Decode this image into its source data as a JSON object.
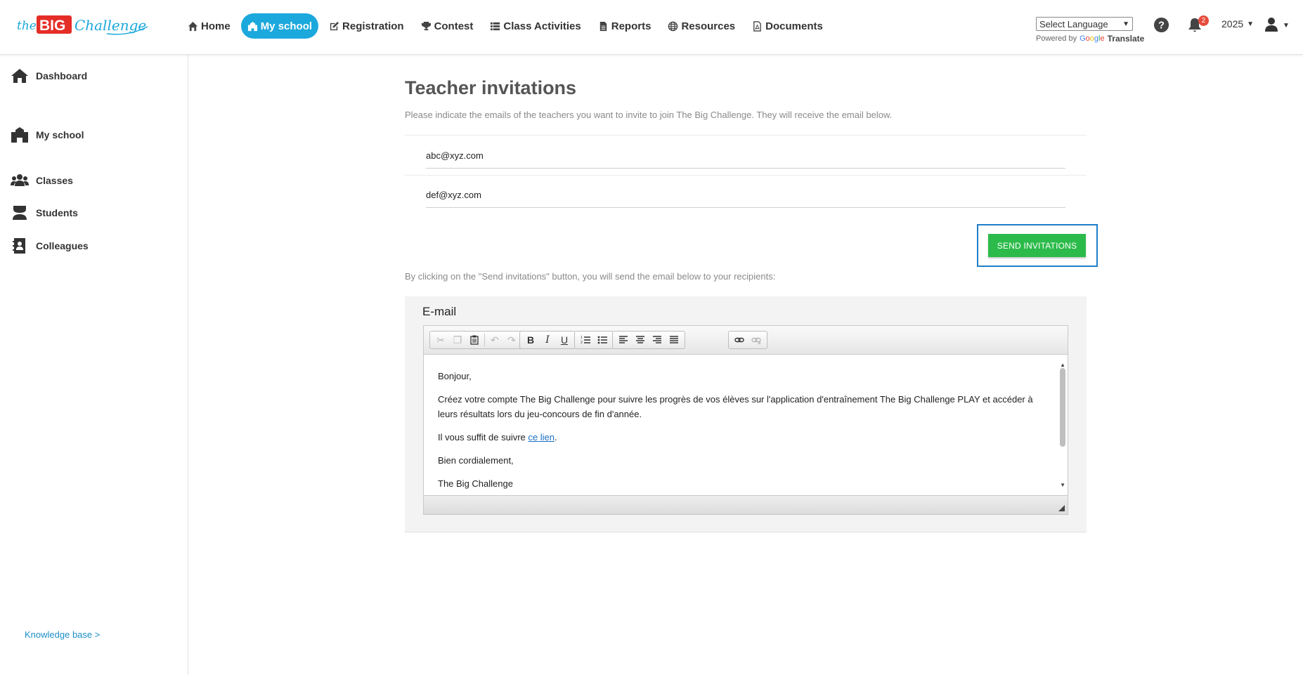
{
  "brand": {
    "logo_the": "the",
    "logo_big": "BIG",
    "logo_challenge": "Challenge",
    "accent": "#1ba8dc",
    "logo_red": "#e52d27"
  },
  "nav": {
    "items": [
      {
        "label": "Home",
        "icon": "home-icon"
      },
      {
        "label": "My school",
        "icon": "school-icon",
        "active": true
      },
      {
        "label": "Registration",
        "icon": "edit-icon"
      },
      {
        "label": "Contest",
        "icon": "trophy-icon"
      },
      {
        "label": "Class Activities",
        "icon": "list-icon"
      },
      {
        "label": "Reports",
        "icon": "file-text-icon"
      },
      {
        "label": "Resources",
        "icon": "globe-icon"
      },
      {
        "label": "Documents",
        "icon": "pdf-icon"
      }
    ]
  },
  "language": {
    "selected": "Select Language",
    "powered_by": "Powered by",
    "google": [
      "G",
      "o",
      "o",
      "g",
      "l",
      "e"
    ],
    "translate": "Translate"
  },
  "header": {
    "notification_count": "2",
    "year": "2025"
  },
  "sidebar": {
    "items": [
      {
        "label": "Dashboard",
        "icon": "home-icon"
      },
      {
        "label": "My school",
        "icon": "school-icon"
      },
      {
        "label": "Classes",
        "icon": "users-icon"
      },
      {
        "label": "Students",
        "icon": "student-icon"
      },
      {
        "label": "Colleagues",
        "icon": "contact-book-icon"
      }
    ],
    "knowledge_base": "Knowledge base >"
  },
  "main": {
    "title": "Teacher invitations",
    "subtitle": "Please indicate the emails of the teachers you want to invite to join The Big Challenge. They will receive the email below.",
    "emails": [
      "abc@xyz.com",
      "def@xyz.com"
    ],
    "send_button": "SEND INVITATIONS",
    "send_color": "#2cbb4a",
    "click_note": "By clicking on the \"Send invitations\" button, you will send the email below to your recipients:",
    "email_heading": "E-mail"
  },
  "editor": {
    "greeting": "Bonjour,",
    "paragraph1": "Créez votre compte The Big Challenge pour suivre les progrès de vos élèves sur l'application d'entraînement The Big Challenge PLAY et accéder à leurs résultats lors du jeu-concours de fin d'année.",
    "paragraph2_before": "Il vous suffit de suivre ",
    "paragraph2_link": "ce lien",
    "paragraph2_after": ".",
    "closing": "Bien cordialement,",
    "signature": "The Big Challenge"
  }
}
